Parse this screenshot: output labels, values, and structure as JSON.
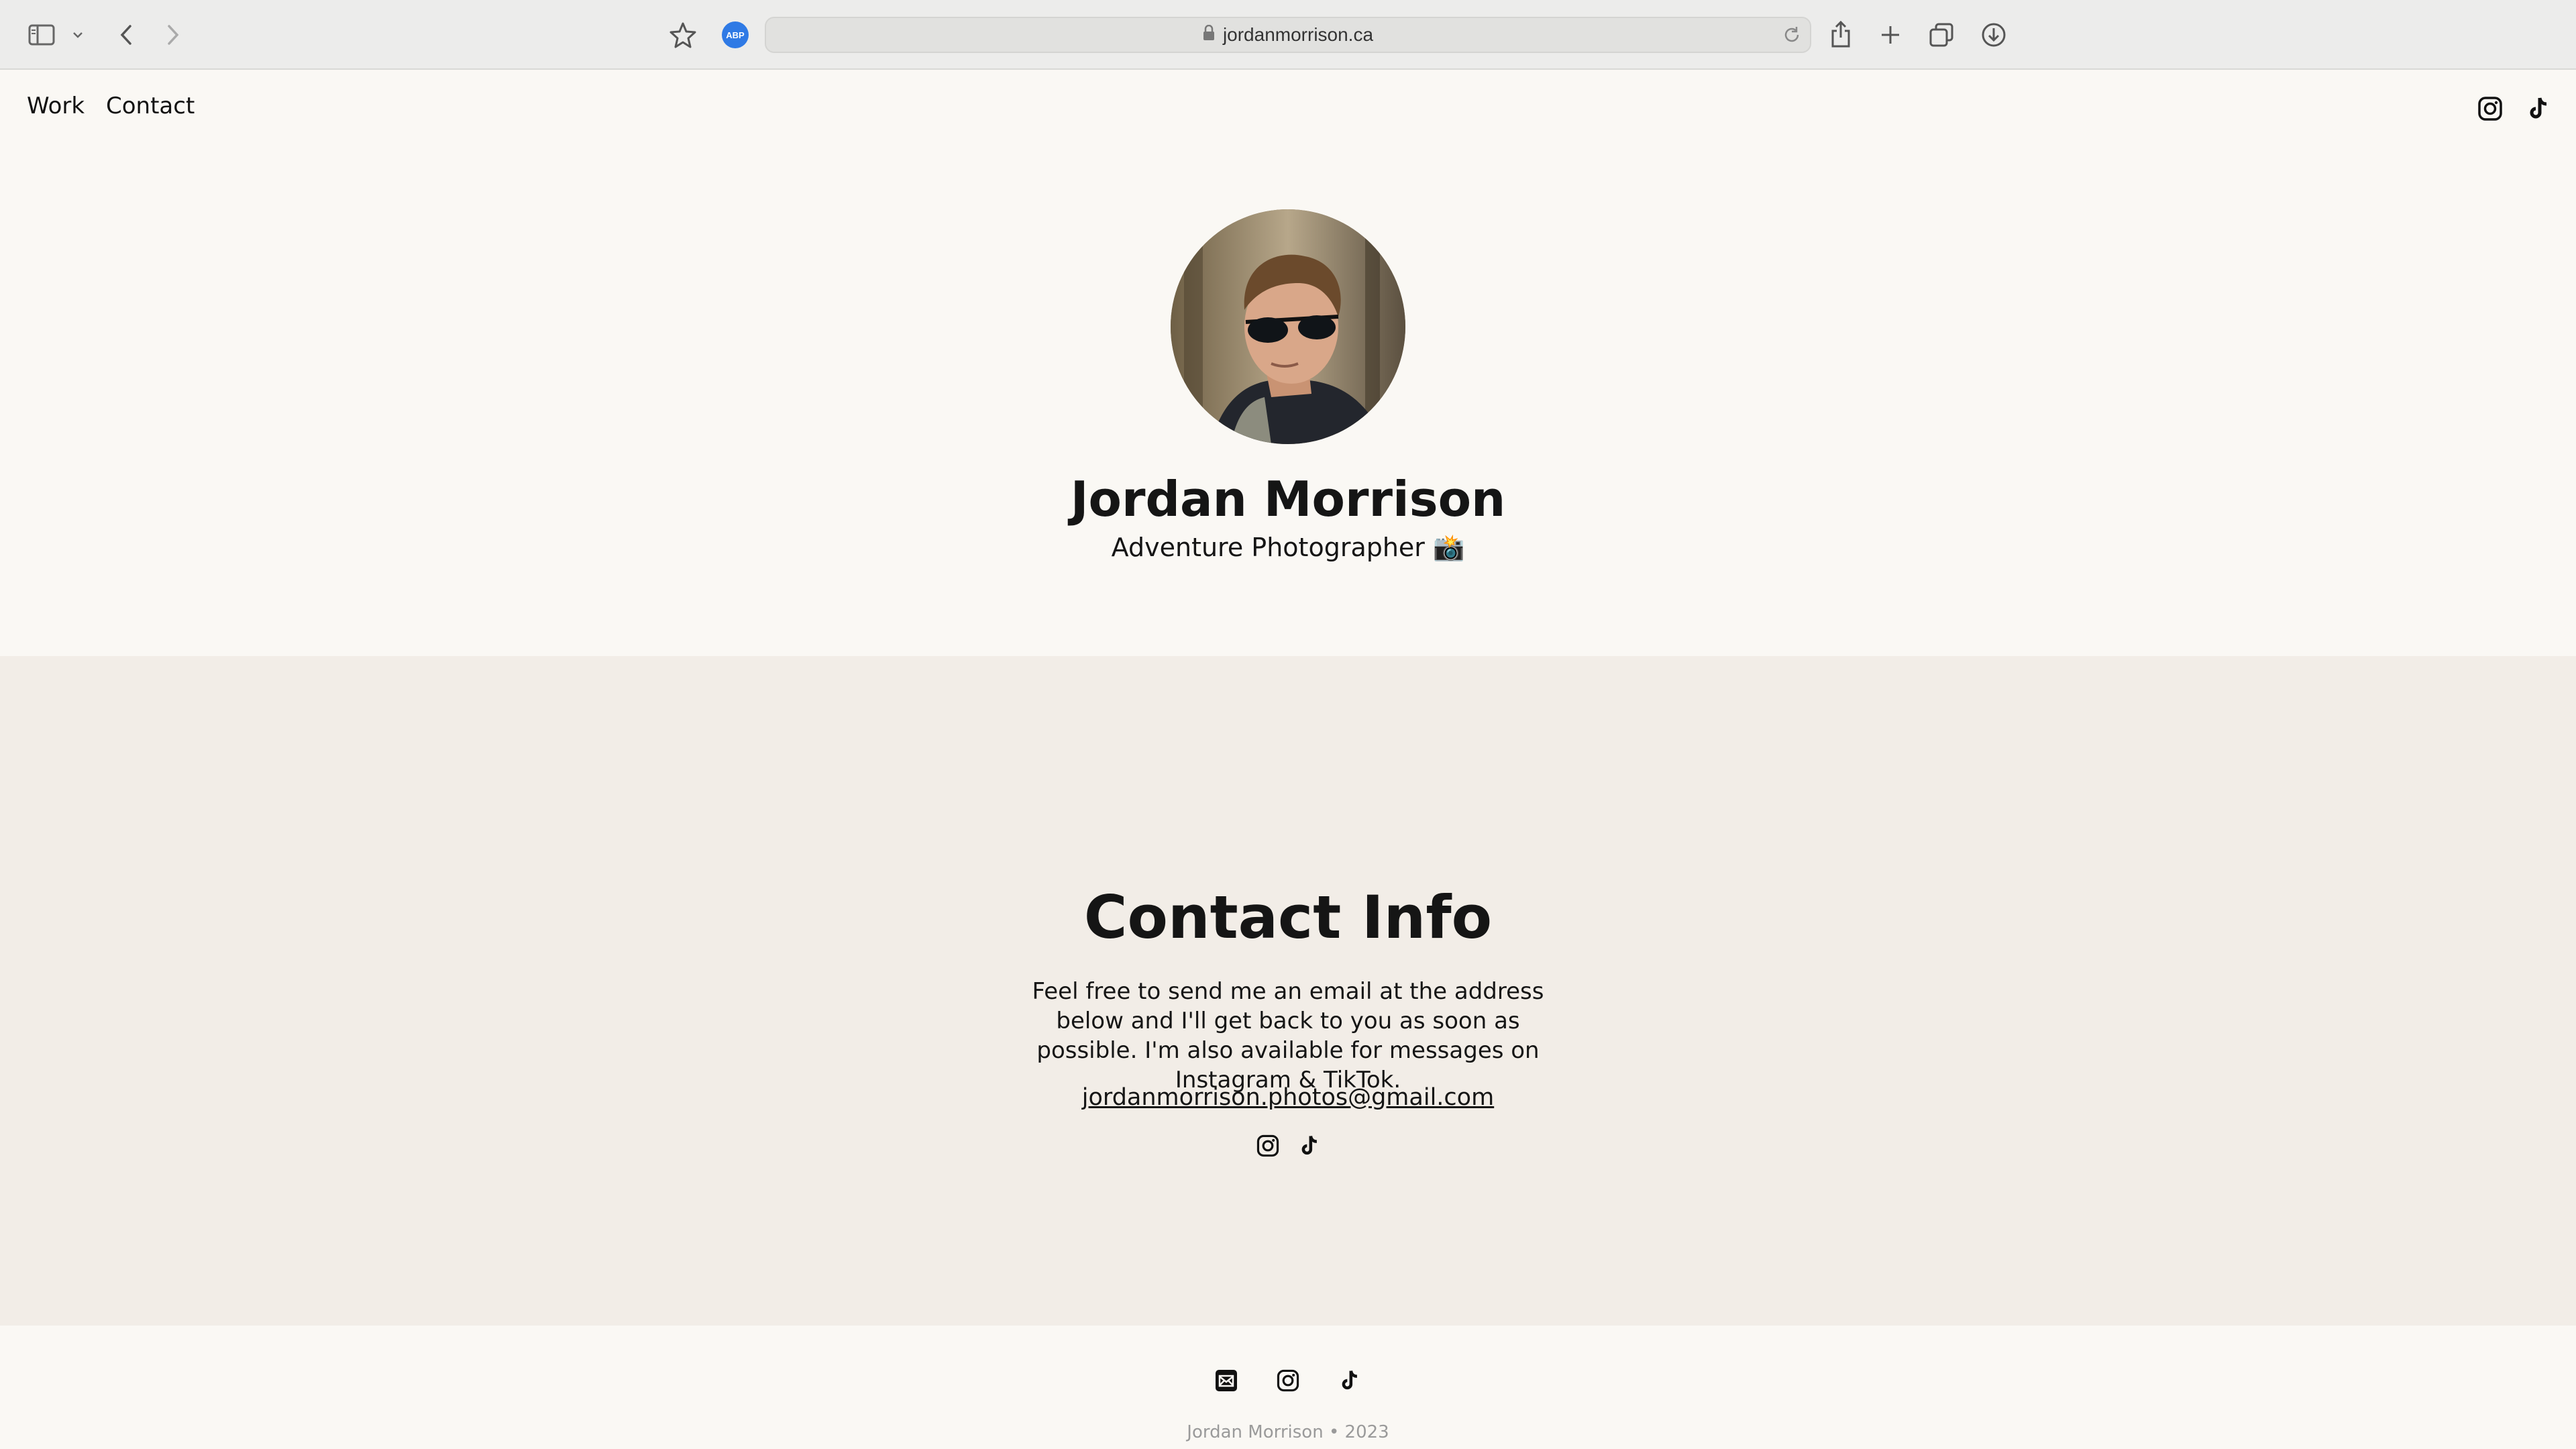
{
  "browser": {
    "url": "jordanmorrison.ca",
    "extension_badge": "ABP",
    "icons": [
      "sidebar-icon",
      "chevron-down-icon",
      "back-icon",
      "forward-icon",
      "star-icon",
      "lock-icon",
      "reload-icon",
      "share-icon",
      "new-tab-icon",
      "tabs-overview-icon",
      "downloads-icon"
    ]
  },
  "nav": {
    "links": [
      {
        "label": "Work"
      },
      {
        "label": "Contact"
      }
    ],
    "social_icons": [
      "instagram-icon",
      "tiktok-icon"
    ]
  },
  "hero": {
    "name": "Jordan Morrison",
    "tagline": "Adventure Photographer 📸"
  },
  "contact": {
    "title": "Contact Info",
    "body": "Feel free to send me an email at the address below and I'll get back to you as soon as possible. I'm also available for messages on Instagram & TikTok.",
    "email": "jordanmorrison.photos@gmail.com",
    "social_icons": [
      "instagram-icon",
      "tiktok-icon"
    ]
  },
  "footer": {
    "icons": [
      "email-icon",
      "instagram-icon",
      "tiktok-icon"
    ],
    "copyright": "Jordan Morrison • 2023"
  },
  "colors": {
    "page_bg": "#faf8f4",
    "contact_bg": "#f2ede7",
    "text": "#151515",
    "browser_bar": "#ececeb",
    "abp_badge": "#2f7ae5"
  }
}
